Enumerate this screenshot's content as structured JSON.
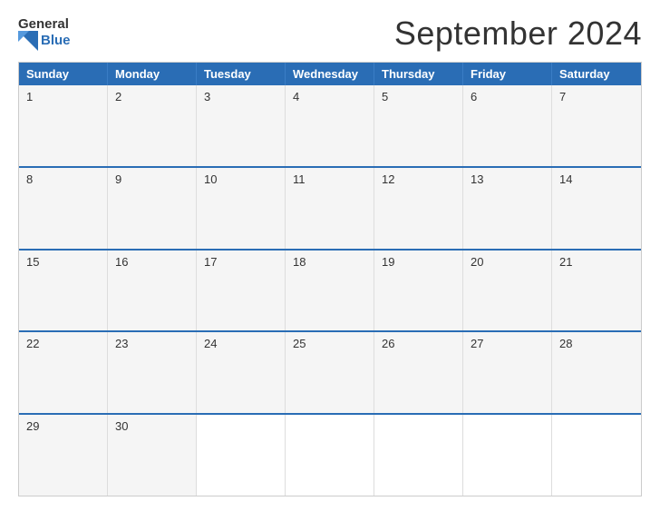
{
  "header": {
    "logo_general": "General",
    "logo_blue": "Blue",
    "title": "September 2024"
  },
  "calendar": {
    "days_of_week": [
      "Sunday",
      "Monday",
      "Tuesday",
      "Wednesday",
      "Thursday",
      "Friday",
      "Saturday"
    ],
    "weeks": [
      [
        {
          "day": 1,
          "empty": false
        },
        {
          "day": 2,
          "empty": false
        },
        {
          "day": 3,
          "empty": false
        },
        {
          "day": 4,
          "empty": false
        },
        {
          "day": 5,
          "empty": false
        },
        {
          "day": 6,
          "empty": false
        },
        {
          "day": 7,
          "empty": false
        }
      ],
      [
        {
          "day": 8,
          "empty": false
        },
        {
          "day": 9,
          "empty": false
        },
        {
          "day": 10,
          "empty": false
        },
        {
          "day": 11,
          "empty": false
        },
        {
          "day": 12,
          "empty": false
        },
        {
          "day": 13,
          "empty": false
        },
        {
          "day": 14,
          "empty": false
        }
      ],
      [
        {
          "day": 15,
          "empty": false
        },
        {
          "day": 16,
          "empty": false
        },
        {
          "day": 17,
          "empty": false
        },
        {
          "day": 18,
          "empty": false
        },
        {
          "day": 19,
          "empty": false
        },
        {
          "day": 20,
          "empty": false
        },
        {
          "day": 21,
          "empty": false
        }
      ],
      [
        {
          "day": 22,
          "empty": false
        },
        {
          "day": 23,
          "empty": false
        },
        {
          "day": 24,
          "empty": false
        },
        {
          "day": 25,
          "empty": false
        },
        {
          "day": 26,
          "empty": false
        },
        {
          "day": 27,
          "empty": false
        },
        {
          "day": 28,
          "empty": false
        }
      ],
      [
        {
          "day": 29,
          "empty": false
        },
        {
          "day": 30,
          "empty": false
        },
        {
          "day": "",
          "empty": true
        },
        {
          "day": "",
          "empty": true
        },
        {
          "day": "",
          "empty": true
        },
        {
          "day": "",
          "empty": true
        },
        {
          "day": "",
          "empty": true
        }
      ]
    ]
  }
}
